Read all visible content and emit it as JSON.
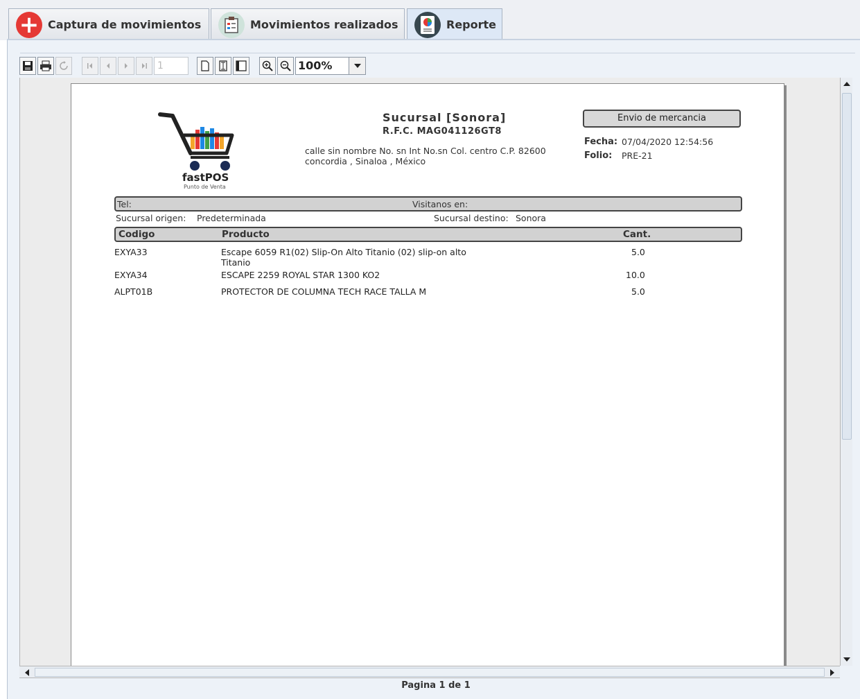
{
  "tabs": [
    {
      "label": "Captura de movimientos",
      "icon": "plus-circle-icon"
    },
    {
      "label": "Movimientos realizados",
      "icon": "clipboard-icon"
    },
    {
      "label": "Reporte",
      "icon": "report-icon",
      "active": true
    }
  ],
  "toolbar": {
    "page_number": "1",
    "zoom": "100%"
  },
  "report": {
    "branch_title": "Sucursal [Sonora]",
    "rfc": "R.F.C. MAG041126GT8",
    "address_line1": "calle sin nombre   No. sn Int No.sn  Col. centro  C.P. 82600",
    "address_line2": "concordia  , Sinaloa , México",
    "doc_title": "Envio de mercancia",
    "fecha_label": "Fecha:",
    "fecha_value": "07/04/2020 12:54:56",
    "folio_label": "Folio:",
    "folio_value": "PRE-21",
    "logo_text": "fastPOS",
    "logo_sub": "Punto de Venta",
    "tel_label": "Tel:",
    "visitanos_label": "Visitanos en:",
    "origen_label": "Sucursal origen:",
    "origen_value": "Predeterminada",
    "destino_label": "Sucursal destino:",
    "destino_value": "Sonora",
    "columns": {
      "codigo": "Codigo",
      "producto": "Producto",
      "cant": "Cant."
    },
    "rows": [
      {
        "codigo": "EXYA33",
        "producto": "Escape 6059 R1(02) Slip-On Alto Titanio (02) slip-on alto",
        "producto2": "Titanio",
        "cant": "5.0"
      },
      {
        "codigo": "EXYA34",
        "producto": "ESCAPE 2259 ROYAL STAR 1300 KO2",
        "producto2": "",
        "cant": "10.0"
      },
      {
        "codigo": "ALPT01B",
        "producto": "PROTECTOR DE COLUMNA TECH RACE TALLA M",
        "producto2": "",
        "cant": "5.0"
      }
    ]
  },
  "status": {
    "page_info": "Pagina 1 de 1"
  }
}
